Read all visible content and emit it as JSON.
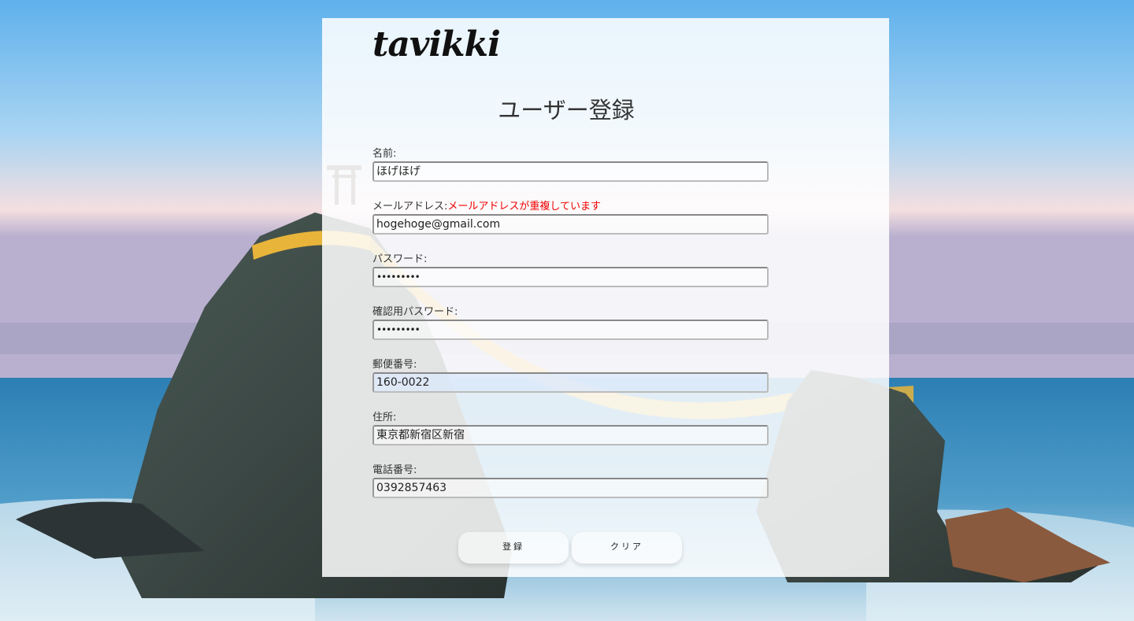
{
  "brand": {
    "logo_text": "tavikki"
  },
  "page": {
    "title": "ユーザー登録"
  },
  "form": {
    "name": {
      "label": "名前:",
      "value": "ほげほげ"
    },
    "email": {
      "label": "メールアドレス:",
      "error": "メールアドレスが重複しています",
      "value": "hogehoge@gmail.com"
    },
    "password": {
      "label": "パスワード:",
      "value": "•••••••••"
    },
    "password_confirm": {
      "label": "確認用パスワード:",
      "value": "•••••••••"
    },
    "postal": {
      "label": "郵便番号:",
      "value": "160-0022"
    },
    "address": {
      "label": "住所:",
      "value": "東京都新宿区新宿"
    },
    "phone": {
      "label": "電話番号:",
      "value": "0392857463"
    }
  },
  "buttons": {
    "submit_label": "登録",
    "clear_label": "クリア"
  },
  "colors": {
    "error": "#ee0000",
    "panel": "#ffffff",
    "sky": "#9cc8ef",
    "sea": "#2f7cae",
    "rope": "#e8b43a"
  }
}
